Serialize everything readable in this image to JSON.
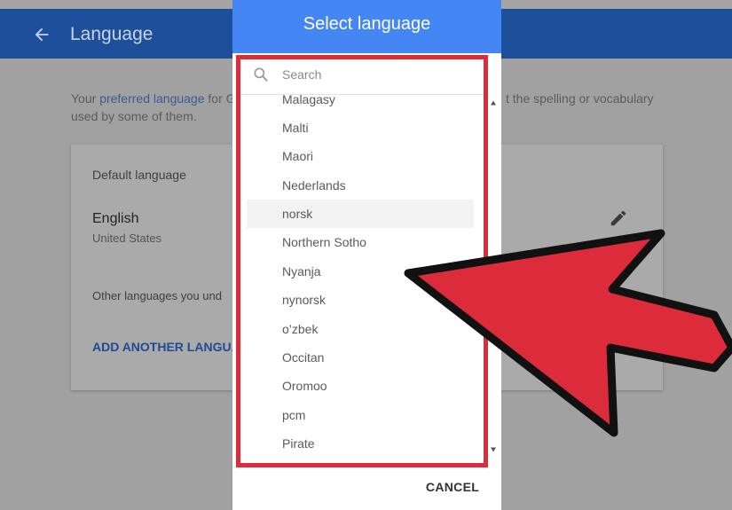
{
  "appbar": {
    "title": "Language",
    "back_icon": "arrow-left-icon"
  },
  "intro": {
    "prefix": "Your ",
    "link": "preferred language",
    "after_link": " for G",
    "suffix_right": "t the spelling or vocabulary",
    "line2": "used by some of them."
  },
  "card": {
    "default_label": "Default language",
    "language_name": "English",
    "language_region": "United States",
    "other_label": "Other languages you und",
    "add_link": "ADD ANOTHER LANGUAG"
  },
  "dialog": {
    "title": "Select language",
    "search_placeholder": "Search",
    "items": [
      "Malagasy",
      "Malti",
      "Maori",
      "Nederlands",
      "norsk",
      "Northern Sotho",
      "Nyanja",
      "nynorsk",
      "o’zbek",
      "Occitan",
      "Oromoo",
      "pcm",
      "Pirate"
    ],
    "hovered_item": "norsk",
    "cancel_label": "CANCEL"
  },
  "colors": {
    "appbar": "#1e4f9a",
    "dialog_header": "#4486f4",
    "highlight_red": "#dc2c3c",
    "link": "#3a5b95"
  }
}
